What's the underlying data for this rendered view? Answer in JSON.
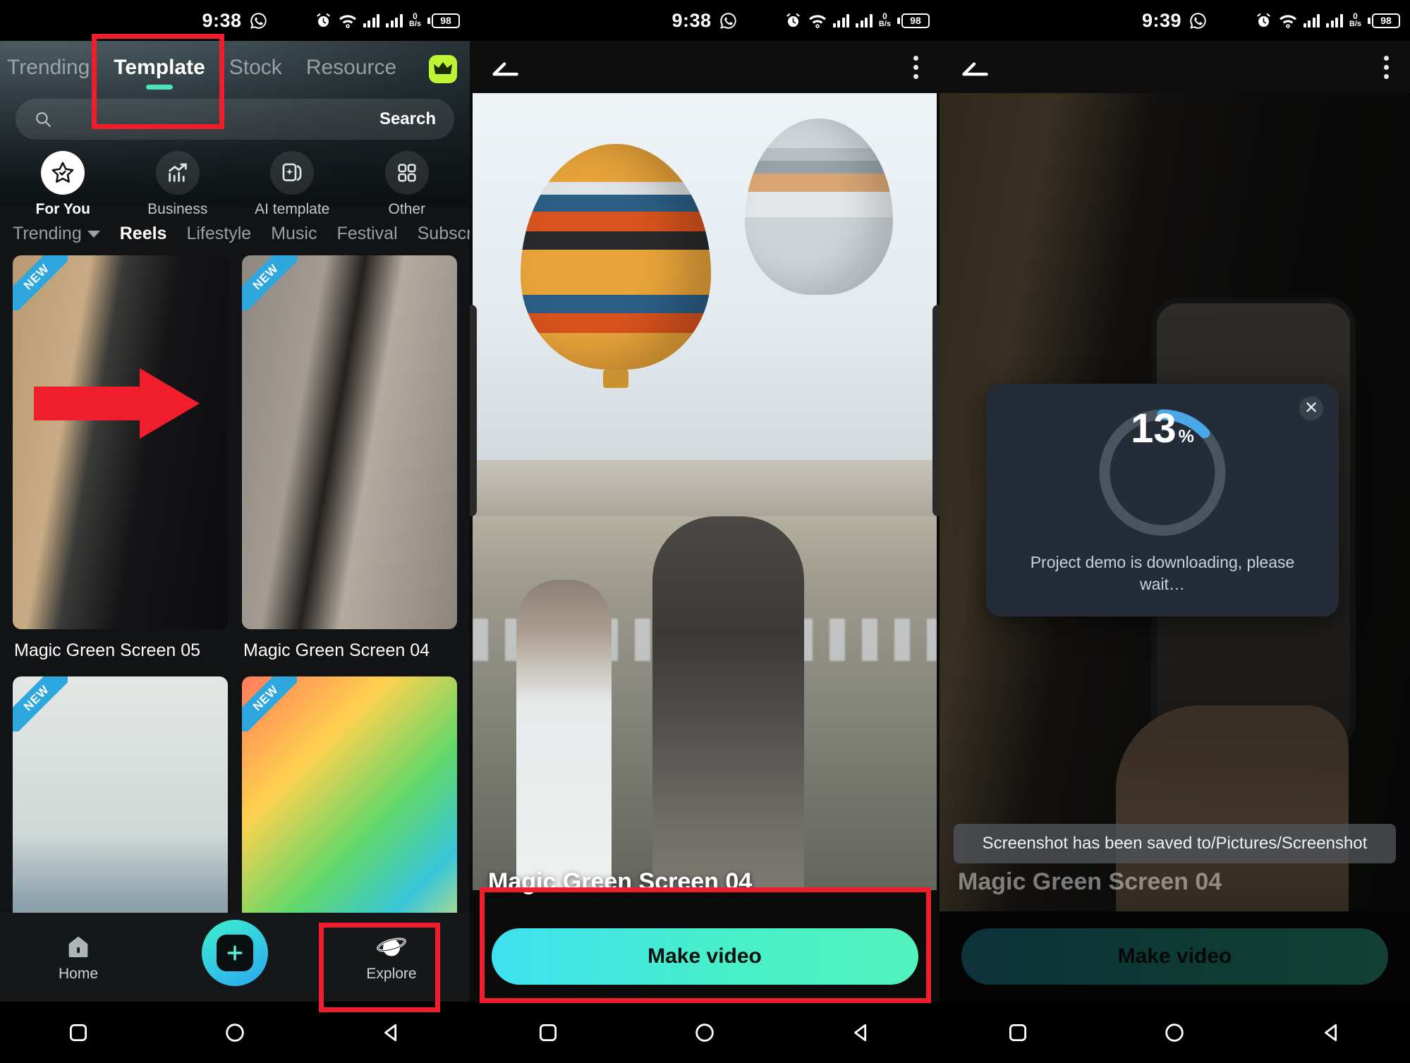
{
  "meta": {
    "accent_green": "#4fe3b8",
    "accent_blue": "#2ea7de",
    "annotation_red": "#f01d2c"
  },
  "phone1": {
    "statusbar": {
      "time": "9:38",
      "whatsapp_icon": "whatsapp-icon",
      "alarm_icon": "alarm-icon",
      "wifi_icon": "wifi-icon",
      "net_speed_value": "0",
      "net_speed_unit": "B/s",
      "battery": "98"
    },
    "top_tabs": [
      {
        "label": "Trending",
        "active": false
      },
      {
        "label": "Template",
        "active": true
      },
      {
        "label": "Stock",
        "active": false
      },
      {
        "label": "Resource",
        "active": false
      }
    ],
    "crown_badge": "crown-icon",
    "search": {
      "placeholder": "",
      "value": "",
      "button_label": "Search",
      "icon": "search-icon"
    },
    "categories": [
      {
        "label": "For You",
        "icon": "star-badge-icon",
        "active": true
      },
      {
        "label": "Business",
        "icon": "chart-trend-icon",
        "active": false
      },
      {
        "label": "AI template",
        "icon": "ai-cards-icon",
        "active": false
      },
      {
        "label": "Other",
        "icon": "grid-squares-icon",
        "active": false
      }
    ],
    "sub_tabs": [
      {
        "label": "Trending",
        "dropdown": true,
        "active": false
      },
      {
        "label": "Reels",
        "dropdown": false,
        "active": true
      },
      {
        "label": "Lifestyle",
        "dropdown": false,
        "active": false
      },
      {
        "label": "Music",
        "dropdown": false,
        "active": false
      },
      {
        "label": "Festival",
        "dropdown": false,
        "active": false
      },
      {
        "label": "Subscr",
        "dropdown": false,
        "active": false
      }
    ],
    "cards": [
      {
        "title": "Magic Green Screen 05",
        "badge": "NEW"
      },
      {
        "title": "Magic Green Screen 04",
        "badge": "NEW"
      },
      {
        "title": "",
        "badge": "NEW"
      },
      {
        "title": "",
        "badge": "NEW"
      }
    ],
    "bottom_nav": [
      {
        "label": "Home",
        "icon": "home-icon"
      },
      {
        "label": "",
        "icon": "plus-icon"
      },
      {
        "label": "Explore",
        "icon": "planet-icon"
      }
    ]
  },
  "phone2": {
    "statusbar": {
      "time": "9:38",
      "whatsapp_icon": "whatsapp-icon",
      "alarm_icon": "alarm-icon",
      "wifi_icon": "wifi-icon",
      "net_speed_value": "0",
      "net_speed_unit": "B/s",
      "battery": "98"
    },
    "appbar": {
      "back_icon": "back-arrow-icon",
      "menu_icon": "kebab-menu-icon"
    },
    "preview_title": "Magic Green Screen 04",
    "make_video_label": "Make video"
  },
  "phone3": {
    "statusbar": {
      "time": "9:39",
      "whatsapp_icon": "whatsapp-icon",
      "alarm_icon": "alarm-icon",
      "wifi_icon": "wifi-icon",
      "net_speed_value": "0",
      "net_speed_unit": "B/s",
      "battery": "98"
    },
    "appbar": {
      "back_icon": "back-arrow-icon",
      "menu_icon": "kebab-menu-icon"
    },
    "preview_title": "Magic Green Screen 04",
    "dialog": {
      "percent_number": "13",
      "percent_symbol": "%",
      "percent_value": 13,
      "message": "Project demo is downloading, please wait…",
      "close_icon": "close-icon"
    },
    "toast": "Screenshot has been saved to/Pictures/Screenshot",
    "make_video_label": "Make video"
  },
  "android_nav": {
    "recents": "square-icon",
    "home": "circle-icon",
    "back": "triangle-back-icon"
  }
}
